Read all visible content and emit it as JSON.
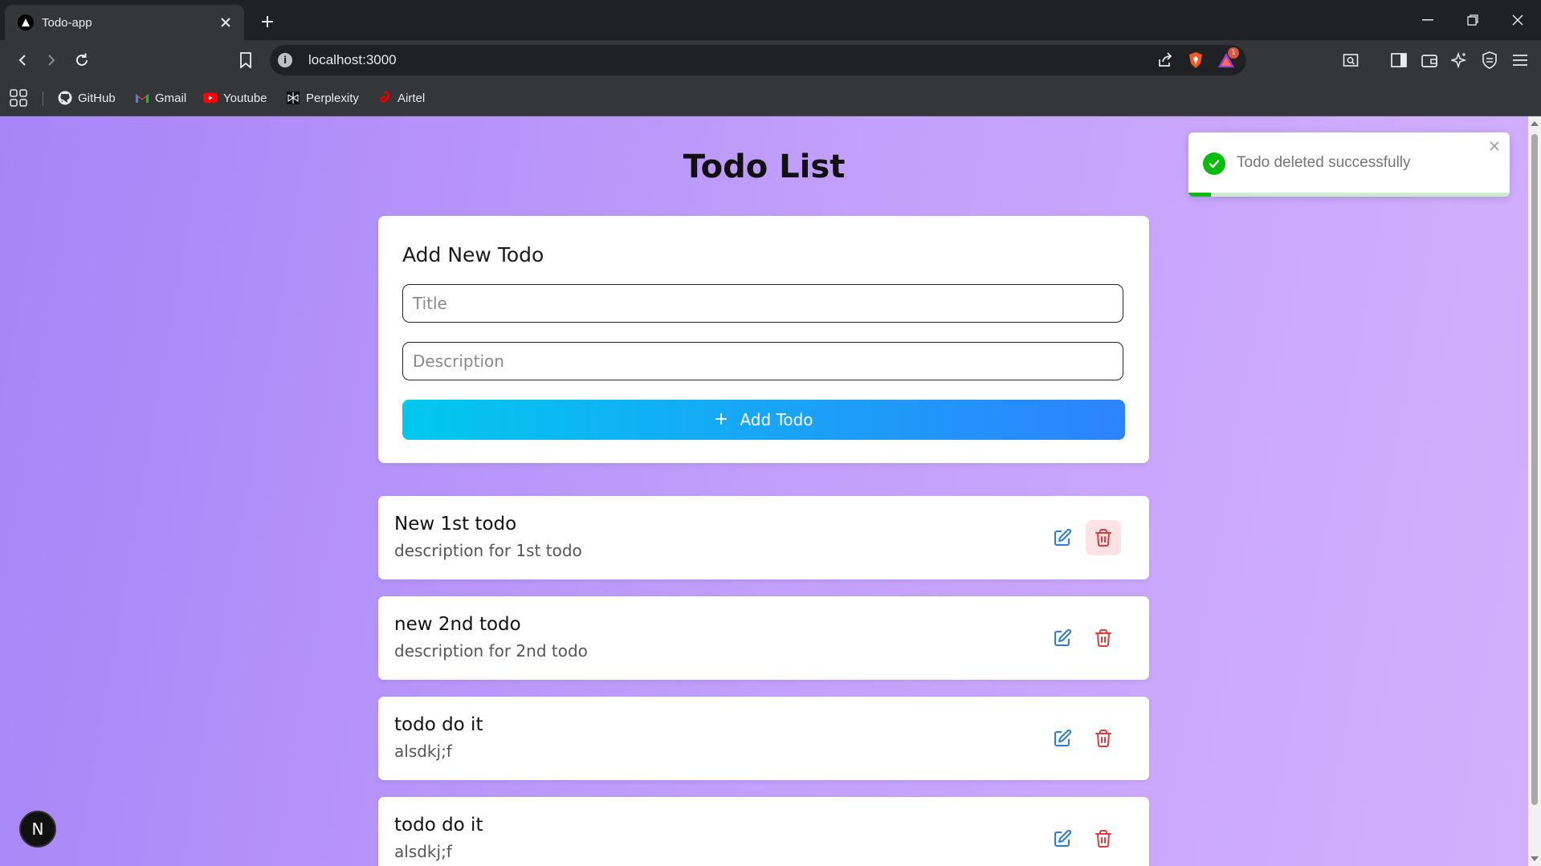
{
  "browser": {
    "tab": {
      "title": "Todo-app"
    },
    "address_bar": {
      "url": "localhost:3000",
      "notification_count": "1"
    },
    "bookmarks": [
      {
        "label": "GitHub",
        "icon": "github-icon"
      },
      {
        "label": "Gmail",
        "icon": "gmail-icon"
      },
      {
        "label": "Youtube",
        "icon": "youtube-icon"
      },
      {
        "label": "Perplexity",
        "icon": "perplexity-icon"
      },
      {
        "label": "Airtel",
        "icon": "airtel-icon"
      }
    ]
  },
  "page": {
    "title": "Todo List",
    "add_form": {
      "heading": "Add New Todo",
      "title_placeholder": "Title",
      "description_placeholder": "Description",
      "submit_label": "Add Todo"
    },
    "todos": [
      {
        "title": "New 1st todo",
        "description": "description for 1st todo"
      },
      {
        "title": "new 2nd todo",
        "description": "description for 2nd todo"
      },
      {
        "title": "todo do it",
        "description": "alsdkj;f"
      },
      {
        "title": "todo do it",
        "description": "alsdkj;f"
      }
    ],
    "toast": {
      "message": "Todo deleted successfully",
      "progress": 0.07
    },
    "dev_badge": {
      "letter": "N"
    }
  },
  "colors": {
    "accent_start": "#02c8ee",
    "accent_end": "#2d83ff",
    "edit_icon": "#2b7be4",
    "delete_icon": "#e5383b",
    "success": "#07bc0c"
  }
}
